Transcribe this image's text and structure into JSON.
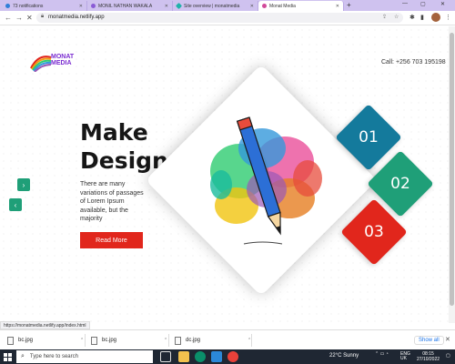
{
  "browser": {
    "tabs": [
      {
        "label": "73 notifications",
        "icon": "notification-favicon",
        "color": "#2f7fd8"
      },
      {
        "label": "MONIL NATHAN WAKALA",
        "icon": "profile-favicon",
        "color": "#8a5bd6"
      },
      {
        "label": "Site overview | monatmedia",
        "icon": "netlify-favicon",
        "color": "#20b2aa"
      },
      {
        "label": "Monat Media",
        "icon": "site-favicon",
        "color": "#d14a9a"
      }
    ],
    "url": "monatmedia.netlify.app"
  },
  "site": {
    "logo_line1": "MONAT",
    "logo_line2": "MEDIA",
    "call": "Call: +256 703 195198",
    "headline_line1": "Make",
    "headline_line2": "Design",
    "description": "There are many variations of passages of Lorem Ipsum available, but the majority",
    "read_more": "Read More",
    "numbers": [
      "01",
      "02",
      "03"
    ],
    "colors": {
      "n01": "#147a9c",
      "n02": "#1f9f78",
      "n03": "#e1261c",
      "accent": "#e1261c",
      "arrow": "#1f9f78"
    }
  },
  "status_url": "https://monatmedia.netlify.app/index.html",
  "downloads": [
    {
      "name": "bc.jpg"
    },
    {
      "name": "bc.jpg"
    },
    {
      "name": "dc.jpg"
    }
  ],
  "downloads_show_all": "Show all",
  "taskbar": {
    "search_placeholder": "Type here to search",
    "weather_temp": "22°C",
    "weather_text": "Sunny",
    "lang_line1": "ENG",
    "lang_line2": "UK",
    "time": "08:15",
    "date": "27/10/2022"
  }
}
